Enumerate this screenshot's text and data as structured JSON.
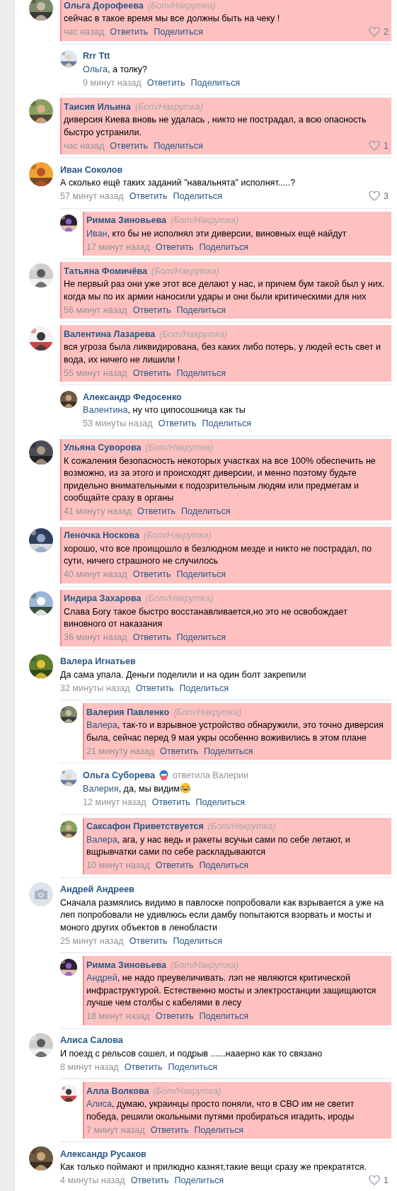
{
  "comments": [
    {
      "author": "Ольга Дорофеева",
      "tag": "(Бот/Накрутка)",
      "highlighted": true,
      "text": "сейчас в такое время мы все должны быть на чеку !",
      "time": "час назад",
      "reply_action": "Ответить",
      "share_action": "Поделиться",
      "likes": "2",
      "replies": [
        {
          "author": "Rrr Ttt",
          "highlighted": false,
          "mention": "Ольга",
          "text": ", а толку?",
          "time": "9 минут назад",
          "reply_action": "Ответить",
          "share_action": "Поделиться"
        }
      ]
    },
    {
      "author": "Таисия Ильина",
      "tag": "(Бот/Накрутка)",
      "highlighted": true,
      "text": "диверсия Киева вновь не удалась , никто не пострадал, а всю опасность быстро устранили.",
      "time": "час назад",
      "reply_action": "Ответить",
      "share_action": "Поделиться",
      "likes": "1"
    },
    {
      "author": "Иван Соколов",
      "highlighted": false,
      "text": "А сколько ещё таких заданий \"навальнята\" исполнят.....?",
      "time": "57 минут назад",
      "reply_action": "Ответить",
      "share_action": "Поделиться",
      "likes": "3",
      "replies": [
        {
          "author": "Римма Зиновьева",
          "tag": "(Бот/Накрутка)",
          "highlighted": true,
          "mention": "Иван",
          "text": ", кто бы не исполнял эти диверсии, виновных ещё найдут",
          "time": "17 минут назад",
          "reply_action": "Ответить",
          "share_action": "Поделиться"
        }
      ]
    },
    {
      "author": "Татьяна Фомичёва",
      "tag": "(Бот/Накрутка)",
      "highlighted": true,
      "text": "Не первый раз они уже этот все делают у нас, и причем бум такой был у них. когда мы по их армии наносили удары и они были критическими для них",
      "time": "56 минут назад",
      "reply_action": "Ответить",
      "share_action": "Поделиться"
    },
    {
      "author": "Валентина Лазарева",
      "tag": "(Бот/Накрутка)",
      "highlighted": true,
      "text": "вся угроза была ликвидирована, без каких либо потерь, у людей есть свет и вода, их ничего не лишили !",
      "time": "55 минут назад",
      "reply_action": "Ответить",
      "share_action": "Поделиться",
      "replies": [
        {
          "author": "Александр Федосенко",
          "highlighted": false,
          "mention": "Валентина",
          "text": ", ну что ципосошница как ты",
          "time": "53 минуты назад",
          "reply_action": "Ответить",
          "share_action": "Поделиться"
        }
      ]
    },
    {
      "author": "Ульяна Суворова",
      "tag": "(Бот/Накрутка)",
      "highlighted": true,
      "text": "К сожаления безопасность некоторых участках на все 100% обеспечить не возможно, из за этого и происходят диверсии, и менно поэтому будьте придельно внимательными к подозрительным людям или предметам и сообщайте сразу в органы",
      "time": "41 минуту назад",
      "reply_action": "Ответить",
      "share_action": "Поделиться"
    },
    {
      "author": "Леночка Носкова",
      "tag": "(Бот/Накрутка)",
      "highlighted": true,
      "text": "хорошо, что все проищошло в безлюдном мезде и никто не пострадал, по сути, ничего страшного не случилось",
      "time": "40 минут назад",
      "reply_action": "Ответить",
      "share_action": "Поделиться"
    },
    {
      "author": "Индира Захарова",
      "tag": "(Бот/Накрутка)",
      "highlighted": true,
      "text": "Слава Богу такое быстро восстанавливается,но это не освобождает виновного от наказания",
      "time": "36 минут назад",
      "reply_action": "Ответить",
      "share_action": "Поделиться"
    },
    {
      "author": "Валера Игнатьев",
      "highlighted": false,
      "text": "Да сама упала. Деньги поделили и на один болт закрепили",
      "time": "32 минуты назад",
      "reply_action": "Ответить",
      "share_action": "Поделиться",
      "replies": [
        {
          "author": "Валерия Павленко",
          "tag": "(Бот/Накрутка)",
          "highlighted": true,
          "mention": "Валера",
          "text": ", так-то и взрывное устройство обнаружили, это точно диверсия была, сейчас перед 9 мая укры особенно воживились в этом плане",
          "time": "21 минуту назад",
          "reply_action": "Ответить",
          "share_action": "Поделиться"
        },
        {
          "author": "Ольга Суборева",
          "badge": true,
          "replied_to": "ответила Валерии",
          "highlighted": false,
          "mention": "Валерия",
          "text": ", да, мы видим",
          "emoji": true,
          "time": "12 минут назад",
          "reply_action": "Ответить",
          "share_action": "Поделиться"
        },
        {
          "author": "Саксафон Приветствуется",
          "tag": "(Бот/Накрутка)",
          "highlighted": true,
          "mention": "Валера",
          "text": ", ага, у нас ведь и ракеты всучьи сами по себе летают, и вщрывчатки сами по себе раскладываются",
          "time": "10 минут назад",
          "reply_action": "Ответить",
          "share_action": "Поделиться"
        }
      ]
    },
    {
      "author": "Андрей Андреев",
      "highlighted": false,
      "avatar": {
        "kind": "camera"
      },
      "text": "Сначала размялись видимо в павлоске попробовали как взрывается а уже на леп попробовали не удивлюсь если дамбу попытаются взорвать и мосты и моного других объектов в ленобласти",
      "time": "25 минут назад",
      "reply_action": "Ответить",
      "share_action": "Поделиться",
      "replies": [
        {
          "author": "Римма Зиновьева",
          "tag": "(Бот/Накрутка)",
          "highlighted": true,
          "mention": "Андрей",
          "text": ", не надо преувеличивать. лэп не являются критической инфраструктурой. Естественно мосты и электростанции защищаются лучше чем столбы с кабелями в лесу",
          "time": "18 минут назад",
          "reply_action": "Ответить",
          "share_action": "Поделиться"
        }
      ]
    },
    {
      "author": "Алиса Салова",
      "highlighted": false,
      "text": "И поезд с рельсов сошел, и подрыв ......нааерно как то связано",
      "time": "8 минут назад",
      "reply_action": "Ответить",
      "share_action": "Поделиться",
      "replies": [
        {
          "author": "Алла Волкова",
          "tag": "(Бот/Накрутка)",
          "highlighted": true,
          "mention": "Алиса",
          "text": ", думаю, украинцы просто поняли, что в СВО им не светит победа, решили окольными путями пробираться игадить, ироды",
          "time": "7 минут назад",
          "reply_action": "Ответить",
          "share_action": "Поделиться"
        }
      ]
    },
    {
      "author": "Александр Русаков",
      "highlighted": false,
      "text": "Как только поймают и прилюдно казнят,такие вещи сразу же прекратятся.",
      "time": "4 минуты назад",
      "reply_action": "Ответить",
      "share_action": "Поделиться",
      "likes": "1"
    }
  ]
}
